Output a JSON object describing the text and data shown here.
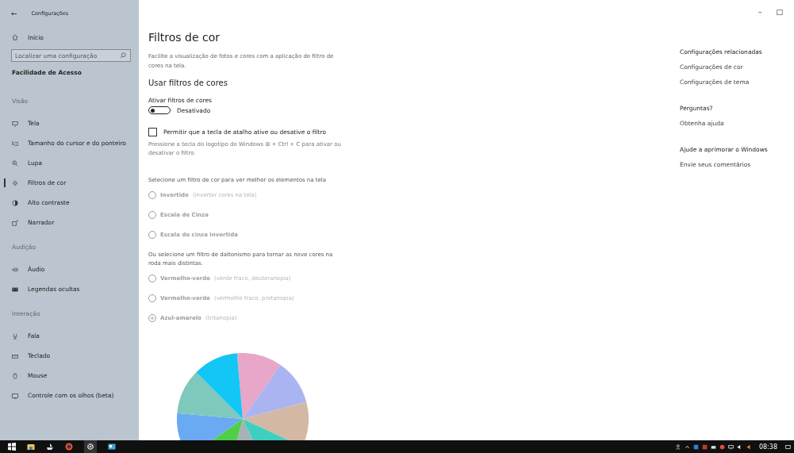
{
  "window": {
    "title": "Configurações",
    "back": "←",
    "controls": [
      "–",
      "□"
    ]
  },
  "sidebar": {
    "home": "Início",
    "search": {
      "placeholder": "Localizar uma configuração"
    },
    "heading": "Facilidade de Acesso",
    "groups": [
      {
        "title": "Visão",
        "items": [
          {
            "label": "Tela",
            "selected": false
          },
          {
            "label": "Tamanho do cursor e do ponteiro",
            "selected": false
          },
          {
            "label": "Lupa",
            "selected": false
          },
          {
            "label": "Filtros de cor",
            "selected": true
          },
          {
            "label": "Alto contraste",
            "selected": false
          },
          {
            "label": "Narrador",
            "selected": false
          }
        ]
      },
      {
        "title": "Audição",
        "items": [
          {
            "label": "Áudio",
            "selected": false
          },
          {
            "label": "Legendas ocultas",
            "selected": false
          }
        ]
      },
      {
        "title": "Interação",
        "items": [
          {
            "label": "Fala",
            "selected": false
          },
          {
            "label": "Teclado",
            "selected": false
          },
          {
            "label": "Mouse",
            "selected": false
          },
          {
            "label": "Controle com os olhos (beta)",
            "selected": false
          }
        ]
      }
    ]
  },
  "main": {
    "title": "Filtros de cor",
    "intro": "Facilite a visualização de fotos e cores com a aplicação do filtro de cores na tela.",
    "section": "Usar filtros de cores",
    "toggle": {
      "label": "Ativar filtros de cores",
      "on": false,
      "state": "Desativado"
    },
    "shortcut": {
      "label": "Permitir que a tecla de atalho ative ou desative o filtro",
      "checked": false,
      "hint": "Pressione a tecla do logotipo do Windows ⊞ + Ctrl + C para ativar ou desativar o filtro."
    },
    "filters_prompt": "Selecione um filtro de cor para ver melhor os elementos na tela",
    "filters": [
      {
        "name": "Invertido",
        "note": "(inverter cores na tela)",
        "selected": false
      },
      {
        "name": "Escala de Cinza",
        "selected": false
      },
      {
        "name": "Escala de cinza invertida",
        "selected": false
      }
    ],
    "cb_prompt": "Ou selecione um filtro de daltonismo para tornar as nove cores na roda mais distintas.",
    "cb_filters": [
      {
        "name": "Vermelho-verde",
        "note": "(verde fraco, deuteranopia)",
        "selected": false
      },
      {
        "name": "Vermelho-verde",
        "note": "(vermelho fraco, protanopia)",
        "selected": false
      },
      {
        "name": "Azul-amarelo",
        "note": "(tritanopia)",
        "selected": true
      }
    ],
    "disabled": true
  },
  "related": [
    {
      "heading": "Configurações relacionadas",
      "links": [
        "Configurações de cor",
        "Configurações de tema"
      ]
    },
    {
      "heading": "Perguntas?",
      "links": [
        "Obtenha ajuda"
      ]
    },
    {
      "heading": "Ajude a aprimorar o Windows",
      "links": [
        "Envie seus comentários"
      ]
    }
  ],
  "taskbar": {
    "time": "08:38"
  }
}
